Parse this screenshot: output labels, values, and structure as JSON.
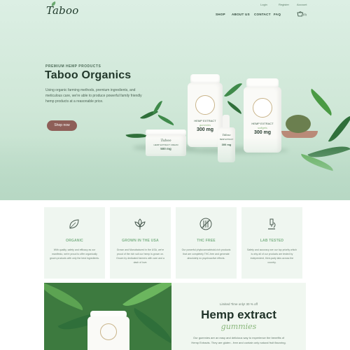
{
  "brand": {
    "logo_text": "Taboo"
  },
  "utility_links": [
    "Login",
    "Register",
    "Account"
  ],
  "nav": {
    "items": [
      "SHOP",
      "ABOUT US",
      "CONTACT",
      "FAQ"
    ],
    "cart_count": "(0)"
  },
  "hero": {
    "eyebrow": "PREMIUM HEMP PRODUCTS",
    "title": "Taboo Organics",
    "description": "Using organic farming methods, premium ingredients, and meticulous care, we're able to produce powerful family friendly hemp products at a reasonable price.",
    "cta_label": "Shop now",
    "products": {
      "bottle_big": {
        "line1": "HEMP EXTRACT",
        "line2": "gummies",
        "strength": "300 mg"
      },
      "bottle_right": {
        "line1": "HEMP EXTRACT",
        "line2": "softgels",
        "strength": "300 mg"
      },
      "jar": {
        "line1": "Taboo",
        "line2": "HEMP EXTRACT CREAM",
        "strength": "500 mg"
      },
      "dropper": {
        "line1": "Taboo",
        "line2": "HEMP EXTRACT",
        "strength": "300 mg"
      }
    }
  },
  "features": [
    {
      "icon": "leaf-icon",
      "title": "ORGANIC",
      "body": "With quality, safety and efficacy as our manifesto, we're proud to offer organically grown products with only the best ingredients."
    },
    {
      "icon": "flower-icon",
      "title": "GROWN IN THE USA",
      "body": "Grown and Manufactured in the USA, we're proud of the rich soil our hemp is grown on. Grown by dedicated farmers with care and a dash of love."
    },
    {
      "icon": "no-thc-icon",
      "title": "THC FREE",
      "body": "Our powerful phytocannabinoid-rich products that are completely THC-free and generate absolutely no psychoactive effects."
    },
    {
      "icon": "microscope-icon",
      "title": "LAB TESTED",
      "body": "Safety and accuracy are our top priority which is why all of our products are tested by independent, third-party labs across the country."
    }
  ],
  "promo": {
    "kicker": "Limited Time only! 30 % off",
    "title": "Hemp extract",
    "script": "gummies",
    "body": "Our gummies are an easy and delicious way to experience the benefits of Hemp Extracts. They are gluten - free and contain only natural fruit flavoring."
  },
  "colors": {
    "accent_green": "#7eb287",
    "button_brown": "#8e5f58",
    "hero_bg": "#cfe7d7"
  }
}
